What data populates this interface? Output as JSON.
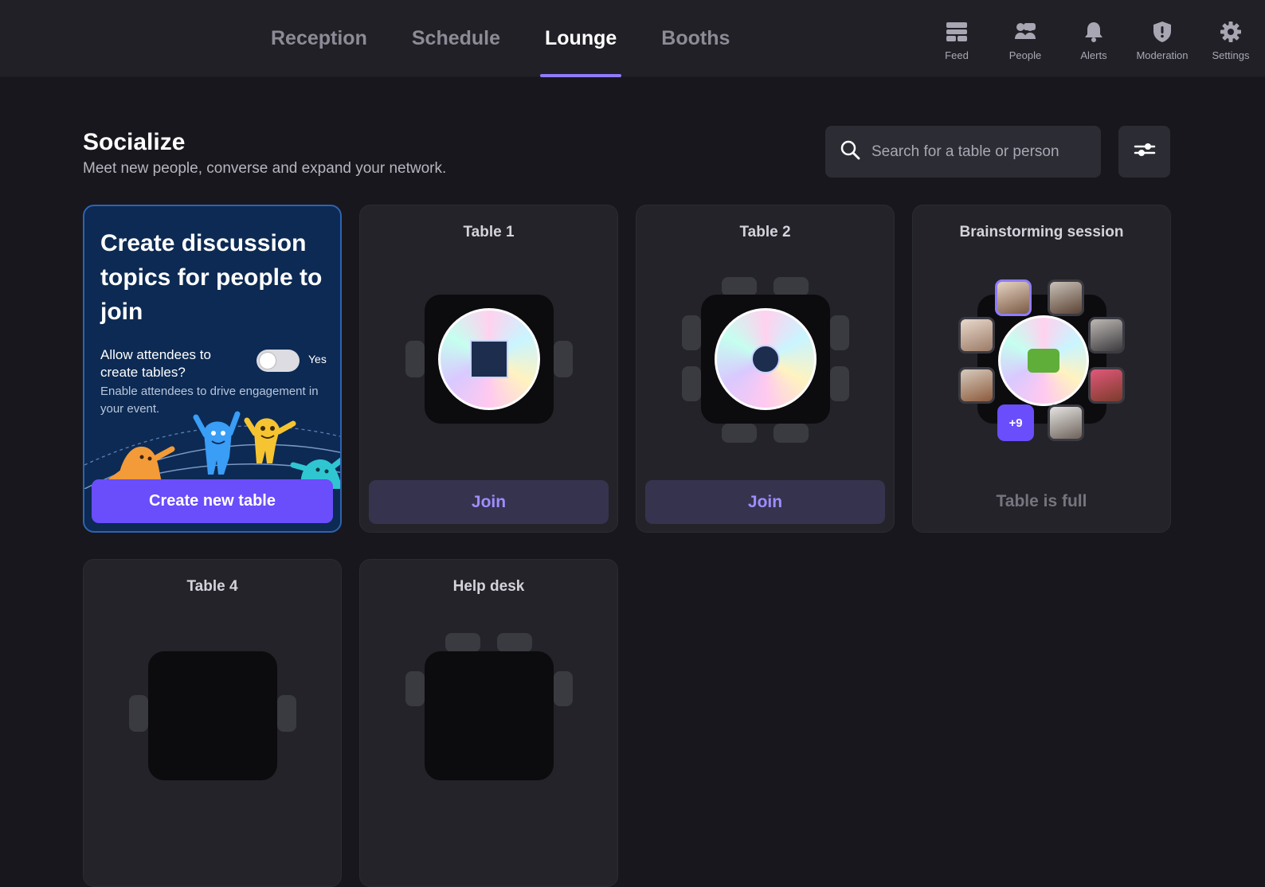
{
  "nav": {
    "tabs": [
      {
        "label": "Reception",
        "active": false
      },
      {
        "label": "Schedule",
        "active": false
      },
      {
        "label": "Lounge",
        "active": true
      },
      {
        "label": "Booths",
        "active": false
      }
    ],
    "tools": [
      {
        "label": "Feed",
        "icon": "feed-icon"
      },
      {
        "label": "People",
        "icon": "people-icon"
      },
      {
        "label": "Alerts",
        "icon": "bell-icon"
      },
      {
        "label": "Moderation",
        "icon": "shield-icon"
      },
      {
        "label": "Settings",
        "icon": "gear-icon"
      }
    ]
  },
  "header": {
    "title": "Socialize",
    "subtitle": "Meet new people, converse and expand your network.",
    "search_placeholder": "Search for a table or person"
  },
  "promo": {
    "title": "Create discussion topics for people to join",
    "allow_label": "Allow attendees to create tables?",
    "toggle_label": "Yes",
    "toggle_on": false,
    "description": "Enable attendees to drive engagement in your event.",
    "button": "Create new table"
  },
  "tables": [
    {
      "name": "Table 1",
      "action": "Join"
    },
    {
      "name": "Table 2",
      "action": "Join"
    },
    {
      "name": "Brainstorming session",
      "status": "Table is full",
      "more": "+9"
    },
    {
      "name": "Table 4"
    },
    {
      "name": "Help desk"
    }
  ],
  "colors": {
    "accent": "#6a4dfb",
    "accent_light": "#9f8dff",
    "background": "#18171d",
    "card": "#232329",
    "promo": "#0c2a53"
  }
}
